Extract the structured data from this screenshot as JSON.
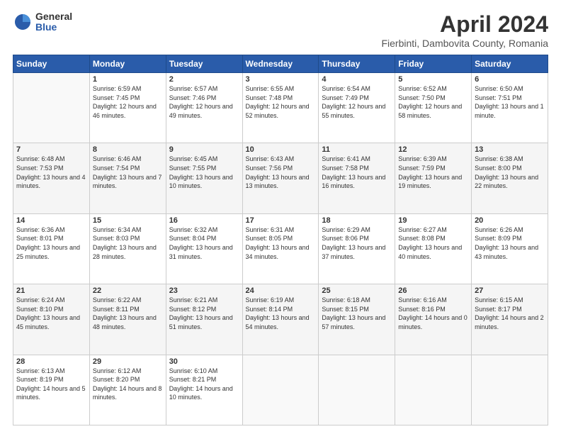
{
  "header": {
    "logo_general": "General",
    "logo_blue": "Blue",
    "title": "April 2024",
    "subtitle": "Fierbinti, Dambovita County, Romania"
  },
  "calendar": {
    "days_of_week": [
      "Sunday",
      "Monday",
      "Tuesday",
      "Wednesday",
      "Thursday",
      "Friday",
      "Saturday"
    ],
    "weeks": [
      [
        {
          "day": "",
          "info": ""
        },
        {
          "day": "1",
          "info": "Sunrise: 6:59 AM\nSunset: 7:45 PM\nDaylight: 12 hours\nand 46 minutes."
        },
        {
          "day": "2",
          "info": "Sunrise: 6:57 AM\nSunset: 7:46 PM\nDaylight: 12 hours\nand 49 minutes."
        },
        {
          "day": "3",
          "info": "Sunrise: 6:55 AM\nSunset: 7:48 PM\nDaylight: 12 hours\nand 52 minutes."
        },
        {
          "day": "4",
          "info": "Sunrise: 6:54 AM\nSunset: 7:49 PM\nDaylight: 12 hours\nand 55 minutes."
        },
        {
          "day": "5",
          "info": "Sunrise: 6:52 AM\nSunset: 7:50 PM\nDaylight: 12 hours\nand 58 minutes."
        },
        {
          "day": "6",
          "info": "Sunrise: 6:50 AM\nSunset: 7:51 PM\nDaylight: 13 hours\nand 1 minute."
        }
      ],
      [
        {
          "day": "7",
          "info": "Sunrise: 6:48 AM\nSunset: 7:53 PM\nDaylight: 13 hours\nand 4 minutes."
        },
        {
          "day": "8",
          "info": "Sunrise: 6:46 AM\nSunset: 7:54 PM\nDaylight: 13 hours\nand 7 minutes."
        },
        {
          "day": "9",
          "info": "Sunrise: 6:45 AM\nSunset: 7:55 PM\nDaylight: 13 hours\nand 10 minutes."
        },
        {
          "day": "10",
          "info": "Sunrise: 6:43 AM\nSunset: 7:56 PM\nDaylight: 13 hours\nand 13 minutes."
        },
        {
          "day": "11",
          "info": "Sunrise: 6:41 AM\nSunset: 7:58 PM\nDaylight: 13 hours\nand 16 minutes."
        },
        {
          "day": "12",
          "info": "Sunrise: 6:39 AM\nSunset: 7:59 PM\nDaylight: 13 hours\nand 19 minutes."
        },
        {
          "day": "13",
          "info": "Sunrise: 6:38 AM\nSunset: 8:00 PM\nDaylight: 13 hours\nand 22 minutes."
        }
      ],
      [
        {
          "day": "14",
          "info": "Sunrise: 6:36 AM\nSunset: 8:01 PM\nDaylight: 13 hours\nand 25 minutes."
        },
        {
          "day": "15",
          "info": "Sunrise: 6:34 AM\nSunset: 8:03 PM\nDaylight: 13 hours\nand 28 minutes."
        },
        {
          "day": "16",
          "info": "Sunrise: 6:32 AM\nSunset: 8:04 PM\nDaylight: 13 hours\nand 31 minutes."
        },
        {
          "day": "17",
          "info": "Sunrise: 6:31 AM\nSunset: 8:05 PM\nDaylight: 13 hours\nand 34 minutes."
        },
        {
          "day": "18",
          "info": "Sunrise: 6:29 AM\nSunset: 8:06 PM\nDaylight: 13 hours\nand 37 minutes."
        },
        {
          "day": "19",
          "info": "Sunrise: 6:27 AM\nSunset: 8:08 PM\nDaylight: 13 hours\nand 40 minutes."
        },
        {
          "day": "20",
          "info": "Sunrise: 6:26 AM\nSunset: 8:09 PM\nDaylight: 13 hours\nand 43 minutes."
        }
      ],
      [
        {
          "day": "21",
          "info": "Sunrise: 6:24 AM\nSunset: 8:10 PM\nDaylight: 13 hours\nand 45 minutes."
        },
        {
          "day": "22",
          "info": "Sunrise: 6:22 AM\nSunset: 8:11 PM\nDaylight: 13 hours\nand 48 minutes."
        },
        {
          "day": "23",
          "info": "Sunrise: 6:21 AM\nSunset: 8:12 PM\nDaylight: 13 hours\nand 51 minutes."
        },
        {
          "day": "24",
          "info": "Sunrise: 6:19 AM\nSunset: 8:14 PM\nDaylight: 13 hours\nand 54 minutes."
        },
        {
          "day": "25",
          "info": "Sunrise: 6:18 AM\nSunset: 8:15 PM\nDaylight: 13 hours\nand 57 minutes."
        },
        {
          "day": "26",
          "info": "Sunrise: 6:16 AM\nSunset: 8:16 PM\nDaylight: 14 hours\nand 0 minutes."
        },
        {
          "day": "27",
          "info": "Sunrise: 6:15 AM\nSunset: 8:17 PM\nDaylight: 14 hours\nand 2 minutes."
        }
      ],
      [
        {
          "day": "28",
          "info": "Sunrise: 6:13 AM\nSunset: 8:19 PM\nDaylight: 14 hours\nand 5 minutes."
        },
        {
          "day": "29",
          "info": "Sunrise: 6:12 AM\nSunset: 8:20 PM\nDaylight: 14 hours\nand 8 minutes."
        },
        {
          "day": "30",
          "info": "Sunrise: 6:10 AM\nSunset: 8:21 PM\nDaylight: 14 hours\nand 10 minutes."
        },
        {
          "day": "",
          "info": ""
        },
        {
          "day": "",
          "info": ""
        },
        {
          "day": "",
          "info": ""
        },
        {
          "day": "",
          "info": ""
        }
      ]
    ]
  }
}
